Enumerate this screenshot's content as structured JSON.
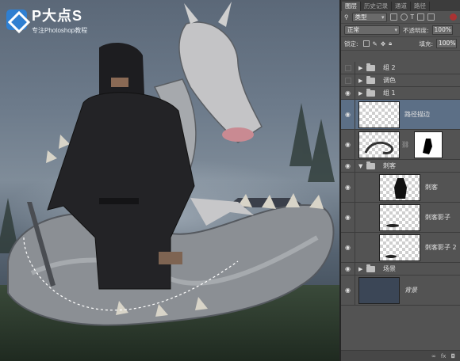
{
  "logo": {
    "title": "P大点S",
    "subtitle": "专注Photoshop教程",
    "icon": "diamond-logo-icon"
  },
  "panel": {
    "tabs": [
      "图层",
      "历史记录",
      "通道",
      "路径"
    ],
    "filter": {
      "label": "类型",
      "icons": [
        "image-filter-icon",
        "adjustment-filter-icon",
        "text-filter-icon",
        "shape-filter-icon",
        "smart-object-filter-icon"
      ]
    },
    "blend_mode": "正常",
    "opacity_label": "不透明度:",
    "opacity_value": "100%",
    "lock_label": "锁定:",
    "fill_label": "填充:",
    "fill_value": "100%",
    "layers": [
      {
        "name": "组 2",
        "type": "group",
        "visible": false,
        "expanded": false
      },
      {
        "name": "调色",
        "type": "group",
        "visible": false,
        "expanded": false
      },
      {
        "name": "组 1",
        "type": "group",
        "visible": true,
        "expanded": false
      },
      {
        "name": "路径描边",
        "type": "layer",
        "visible": true,
        "selected": true
      },
      {
        "name": "",
        "type": "masked",
        "visible": true
      },
      {
        "name": "刺客",
        "type": "group",
        "visible": true,
        "expanded": true
      },
      {
        "name": "刺客",
        "type": "layer",
        "visible": true
      },
      {
        "name": "刺客影子",
        "type": "layer",
        "visible": true
      },
      {
        "name": "刺客影子 2",
        "type": "layer",
        "visible": true
      },
      {
        "name": "场景",
        "type": "group",
        "visible": true,
        "expanded": false
      },
      {
        "name": "背景",
        "type": "background",
        "visible": true
      }
    ],
    "footer_icons": [
      "link-icon",
      "fx-icon",
      "mask-icon"
    ],
    "footer_text": [
      "∞",
      "fx",
      "◘"
    ]
  }
}
